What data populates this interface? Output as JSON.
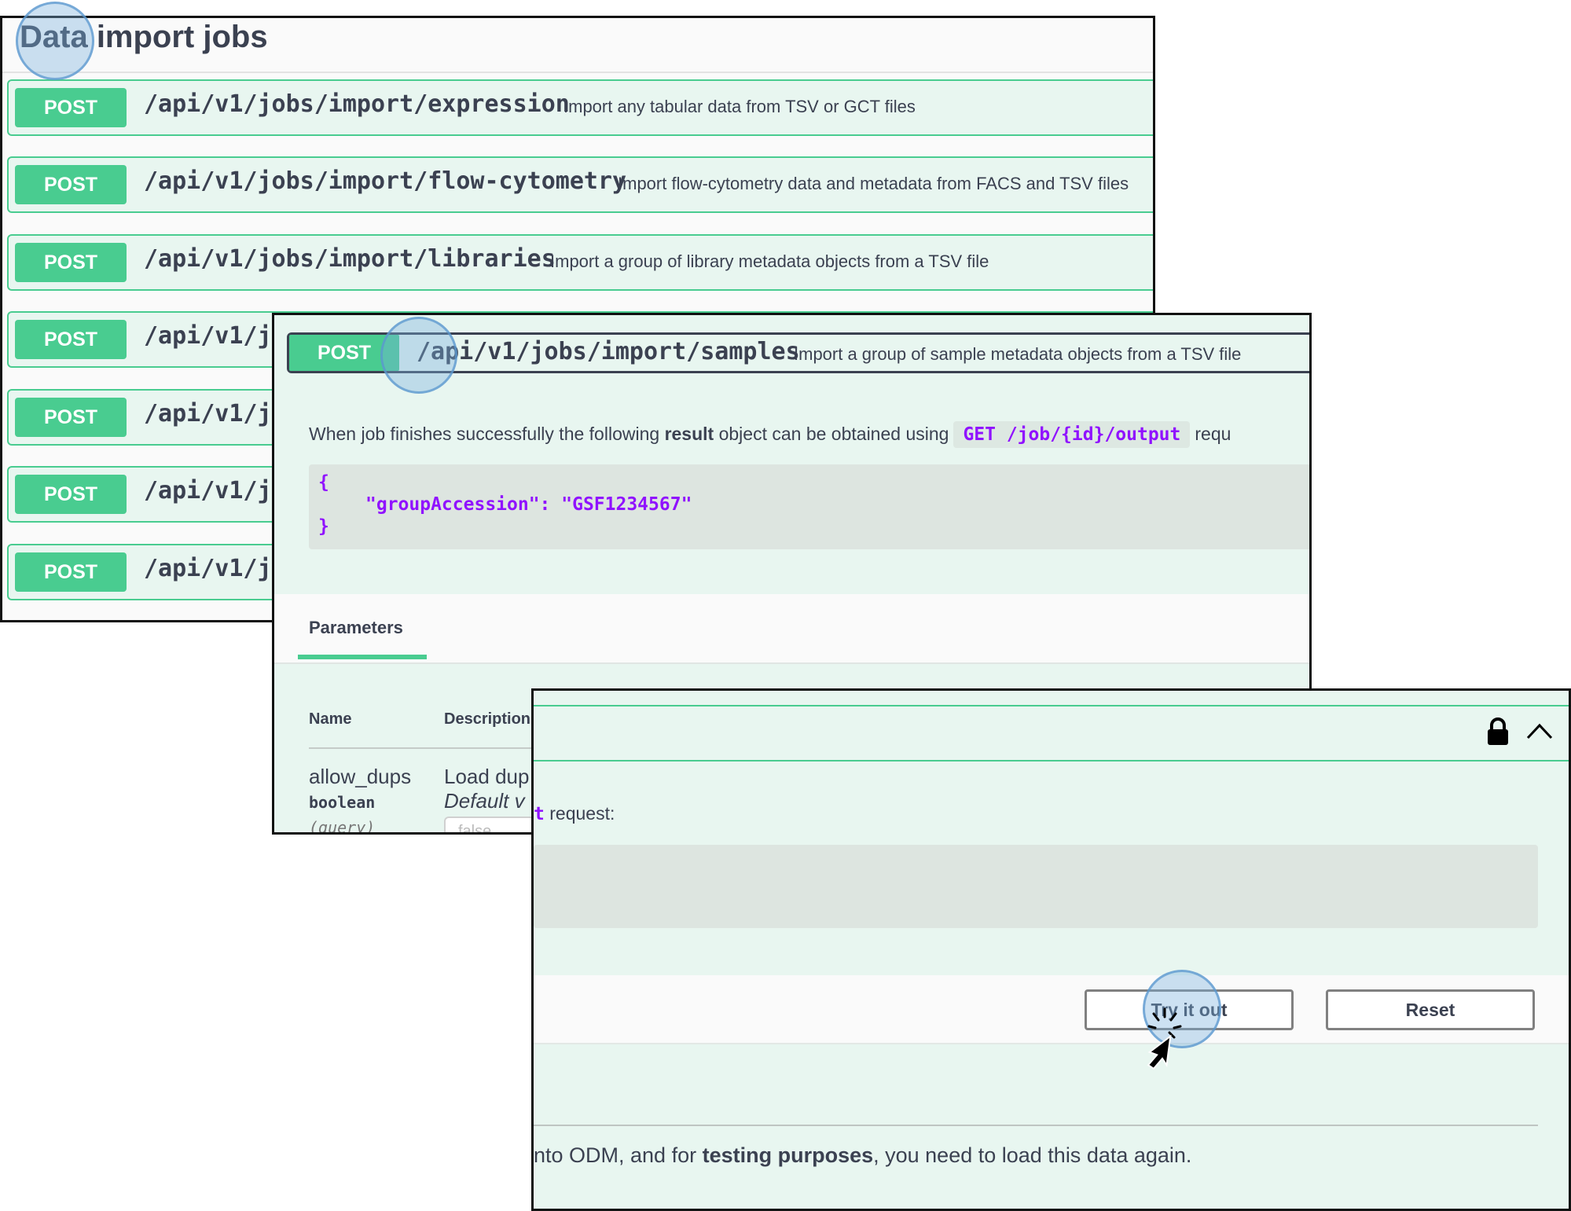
{
  "panel1": {
    "title": "Data import jobs",
    "operations": [
      {
        "method": "POST",
        "path": "/api/v1/jobs/import/expression",
        "description": "Import any tabular data from TSV or GCT files"
      },
      {
        "method": "POST",
        "path": "/api/v1/jobs/import/flow-cytometry",
        "description": "Import flow-cytometry data and metadata from FACS and TSV files"
      },
      {
        "method": "POST",
        "path": "/api/v1/jobs/import/libraries",
        "description": "Import a group of library metadata objects from a TSV file"
      },
      {
        "method": "POST",
        "path": "/api/v1/jo",
        "description": ""
      },
      {
        "method": "POST",
        "path": "/api/v1/jo",
        "description": ""
      },
      {
        "method": "POST",
        "path": "/api/v1/jo",
        "description": ""
      },
      {
        "method": "POST",
        "path": "/api/v1/jo",
        "description": ""
      }
    ]
  },
  "panel2": {
    "method": "POST",
    "path": "/api/v1/jobs/import/samples",
    "description": "Import a group of sample metadata objects from a TSV file",
    "result_text_before": "When job finishes successfully the following ",
    "result_bold": "result",
    "result_text_after": " object can be obtained using",
    "result_code": "GET /job/{id}/output",
    "result_tail": "requ",
    "code_line1": "{",
    "code_line2": "\"groupAccession\": \"GSF1234567\"",
    "code_line3": "}",
    "params_tab": "Parameters",
    "col_name": "Name",
    "col_description": "Description",
    "param": {
      "name": "allow_dups",
      "type": "boolean",
      "in": "(query)",
      "desc_line1": "Load dup",
      "desc_line2": "Default v",
      "select_value": "false"
    }
  },
  "panel3": {
    "request_code_fragment": "t",
    "request_text": " request:",
    "try_button": "Try it out",
    "reset_button": "Reset",
    "bottom_text_before": "nto ODM, and for ",
    "bottom_bold": "testing purposes",
    "bottom_text_after": ", you need to load this data again.",
    "icons": {
      "lock": "lock-icon",
      "collapse": "chevron-up-icon",
      "cursor": "cursor-icon"
    }
  },
  "colors": {
    "post": "#49cc90",
    "post_bg": "#e8f6f0",
    "code": "#9012fe",
    "text": "#3b4151"
  }
}
